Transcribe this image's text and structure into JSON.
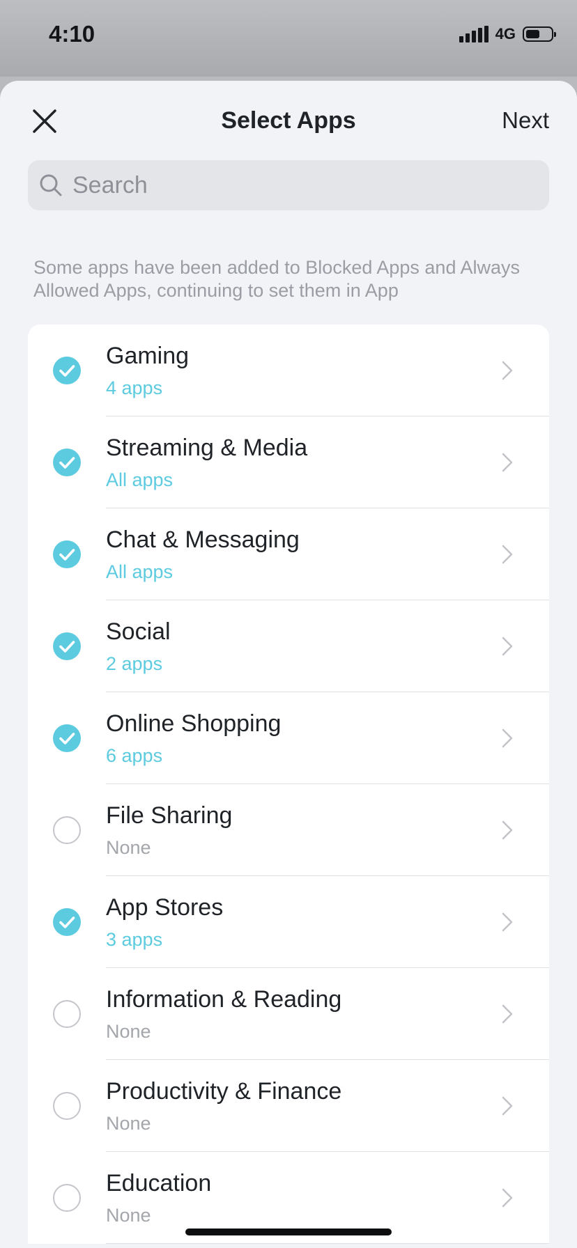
{
  "status_bar": {
    "time": "4:10",
    "network": "4G",
    "battery_level": 0.55
  },
  "header": {
    "title": "Select Apps",
    "next_label": "Next",
    "close_icon": "close-icon"
  },
  "search": {
    "placeholder": "Search",
    "value": ""
  },
  "note": "Some apps have been added to Blocked Apps and Always Allowed Apps, continuing to set them in App",
  "colors": {
    "accent": "#5ccbe0",
    "muted": "#a3a6ab",
    "background": "#f2f3f7"
  },
  "categories": [
    {
      "label": "Gaming",
      "sub": "4 apps",
      "checked": true
    },
    {
      "label": "Streaming & Media",
      "sub": "All apps",
      "checked": true
    },
    {
      "label": "Chat & Messaging",
      "sub": "All apps",
      "checked": true
    },
    {
      "label": "Social",
      "sub": "2 apps",
      "checked": true
    },
    {
      "label": "Online Shopping",
      "sub": "6 apps",
      "checked": true
    },
    {
      "label": "File Sharing",
      "sub": "None",
      "checked": false
    },
    {
      "label": "App Stores",
      "sub": "3 apps",
      "checked": true
    },
    {
      "label": "Information & Reading",
      "sub": "None",
      "checked": false
    },
    {
      "label": "Productivity & Finance",
      "sub": "None",
      "checked": false
    },
    {
      "label": "Education",
      "sub": "None",
      "checked": false
    }
  ]
}
